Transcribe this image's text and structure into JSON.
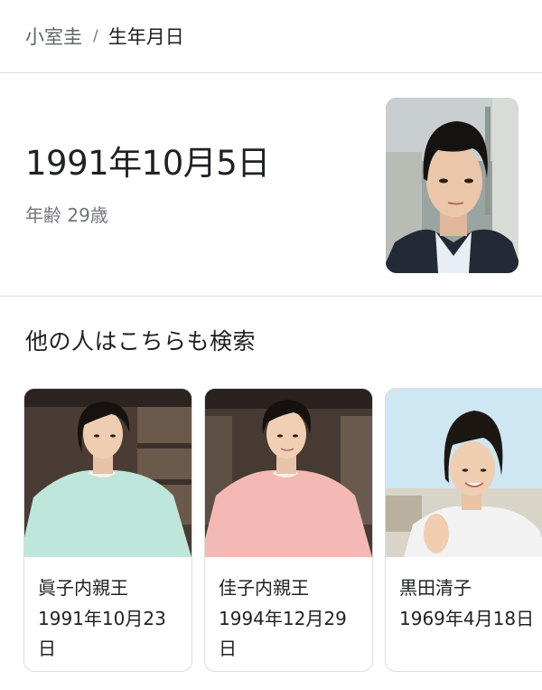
{
  "breadcrumb": {
    "parent": "小室圭",
    "separator": "/",
    "current": "生年月日"
  },
  "answer": {
    "value": "1991年10月5日",
    "age": "年齢 29歳"
  },
  "related": {
    "title": "他の人はこちらも検索",
    "items": [
      {
        "name": "眞子内親王",
        "date": "1991年10月23日"
      },
      {
        "name": "佳子内親王",
        "date": "1994年12月29日"
      },
      {
        "name": "黒田清子",
        "date": "1969年4月18日"
      }
    ]
  },
  "colors": {
    "text_primary": "#202124",
    "text_secondary": "#70757a",
    "divider": "#dadce0",
    "dress_mint": "#bfe6da",
    "dress_pink": "#f4b9b4",
    "jacket_white": "#f2f2f2"
  }
}
